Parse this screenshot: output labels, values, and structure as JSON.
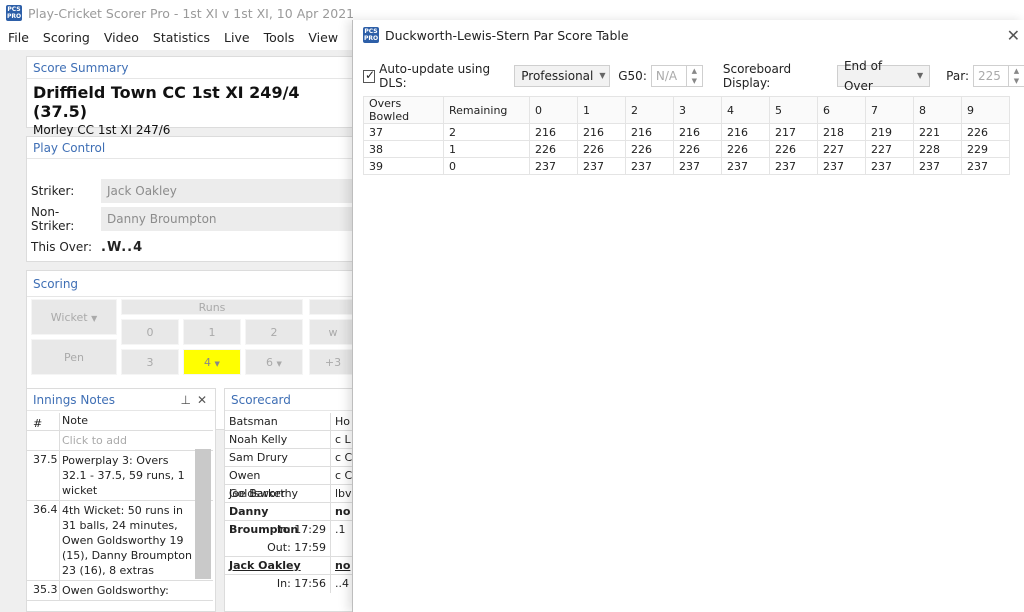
{
  "app": {
    "title": "Play-Cricket Scorer Pro - 1st XI v 1st XI, 10 Apr 2021",
    "icon_label": "PCS PRO",
    "menu": [
      "File",
      "Scoring",
      "Video",
      "Statistics",
      "Live",
      "Tools",
      "View"
    ]
  },
  "score_summary": {
    "header": "Score Summary",
    "batting_team": "Driffield Town CC 1st XI 249/4 (37.5)",
    "bowling_team": "Morley CC 1st XI 247/6"
  },
  "play_control": {
    "header": "Play Control",
    "striker_label": "Striker:",
    "striker": "Jack Oakley",
    "non_striker_label": "Non-Striker:",
    "non_striker": "Danny Broumpton",
    "this_over_label": "This Over:",
    "this_over": ".W..4"
  },
  "scoring": {
    "header": "Scoring",
    "wicket": "Wicket",
    "pen": "Pen",
    "runs_label": "Runs",
    "row1": [
      "0",
      "1",
      "2",
      "w"
    ],
    "row2": [
      "3",
      "4",
      "6",
      "+3"
    ]
  },
  "innings_notes": {
    "header": "Innings Notes",
    "col_num": "#",
    "col_note": "Note",
    "placeholder": "Click to add",
    "rows": [
      {
        "num": "37.5",
        "note": "Powerplay 3: Overs 32.1 - 37.5, 59 runs, 1 wicket"
      },
      {
        "num": "36.4",
        "note": "4th Wicket: 50 runs in 31 balls, 24 minutes, Owen Goldsworthy 19 (15), Danny Broumpton 23 (16), 8 extras"
      },
      {
        "num": "35.3",
        "note": "Owen Goldsworthy:"
      }
    ]
  },
  "scorecard": {
    "header": "Scorecard",
    "col_batsman": "Batsman",
    "col_how": "Ho",
    "rows": [
      {
        "name": "Noah Kelly",
        "how": "c L"
      },
      {
        "name": "Sam Drury",
        "how": "c C"
      },
      {
        "name": "Owen Goldsworthy",
        "how": "c C"
      },
      {
        "name": "Joe Barker",
        "how": "lbv"
      },
      {
        "name": "Danny Broumpton",
        "how": "no"
      },
      {
        "name": "In: 17:29",
        "how": ".1"
      },
      {
        "name": "Out: 17:59",
        "how": ""
      },
      {
        "name": "Jack Oakley",
        "how": "no"
      },
      {
        "name": "In: 17:56",
        "how": "..4"
      }
    ]
  },
  "dls": {
    "title": "Duckworth-Lewis-Stern Par Score Table",
    "icon_label": "PCS PRO",
    "close": "✕",
    "auto_update_label": "Auto-update using DLS:",
    "mode": "Professional",
    "g50_label": "G50:",
    "g50_value": "N/A",
    "scoreboard_label": "Scoreboard Display:",
    "scoreboard_value": "End of Over",
    "par_label": "Par:",
    "par_value": "225",
    "columns": [
      "Overs Bowled",
      "Remaining",
      "0",
      "1",
      "2",
      "3",
      "4",
      "5",
      "6",
      "7",
      "8",
      "9"
    ],
    "rows": [
      [
        "37",
        "2",
        "216",
        "216",
        "216",
        "216",
        "216",
        "217",
        "218",
        "219",
        "221",
        "226"
      ],
      [
        "38",
        "1",
        "226",
        "226",
        "226",
        "226",
        "226",
        "226",
        "227",
        "227",
        "228",
        "229"
      ],
      [
        "39",
        "0",
        "237",
        "237",
        "237",
        "237",
        "237",
        "237",
        "237",
        "237",
        "237",
        "237"
      ]
    ]
  }
}
